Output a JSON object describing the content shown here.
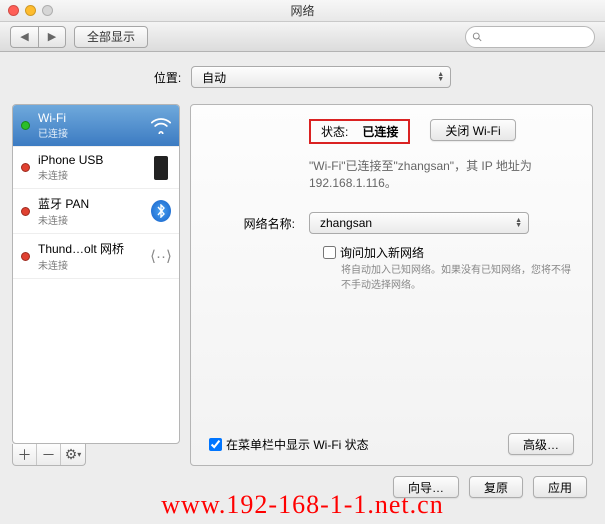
{
  "window": {
    "title": "网络"
  },
  "toolbar": {
    "back_aria": "back",
    "forward_aria": "forward",
    "show_all": "全部显示",
    "search_placeholder": ""
  },
  "location": {
    "label": "位置:",
    "value": "自动"
  },
  "sidebar": {
    "items": [
      {
        "name": "Wi-Fi",
        "status": "已连接",
        "dot": "green",
        "icon": "wifi",
        "selected": true
      },
      {
        "name": "iPhone USB",
        "status": "未连接",
        "dot": "red",
        "icon": "phone",
        "selected": false
      },
      {
        "name": "蓝牙 PAN",
        "status": "未连接",
        "dot": "red",
        "icon": "bluetooth",
        "selected": false
      },
      {
        "name": "Thund…olt 网桥",
        "status": "未连接",
        "dot": "red",
        "icon": "thunderbolt",
        "selected": false
      }
    ],
    "add": "＋",
    "remove": "－",
    "gear": "⚙"
  },
  "main": {
    "status_label": "状态:",
    "status_value": "已连接",
    "toggle_wifi": "关闭 Wi-Fi",
    "status_note": "\"Wi-Fi\"已连接至\"zhangsan\"，其 IP 地址为 192.168.1.116。",
    "network_label": "网络名称:",
    "network_value": "zhangsan",
    "ask_join": "询问加入新网络",
    "ask_join_note": "将自动加入已知网络。如果没有已知网络，您将不得不手动选择网络。",
    "show_menubar": "在菜单栏中显示 Wi-Fi 状态",
    "advanced": "高级…"
  },
  "footer": {
    "assist": "向导…",
    "revert": "复原",
    "apply": "应用"
  },
  "watermark": "www.192-168-1-1.net.cn"
}
